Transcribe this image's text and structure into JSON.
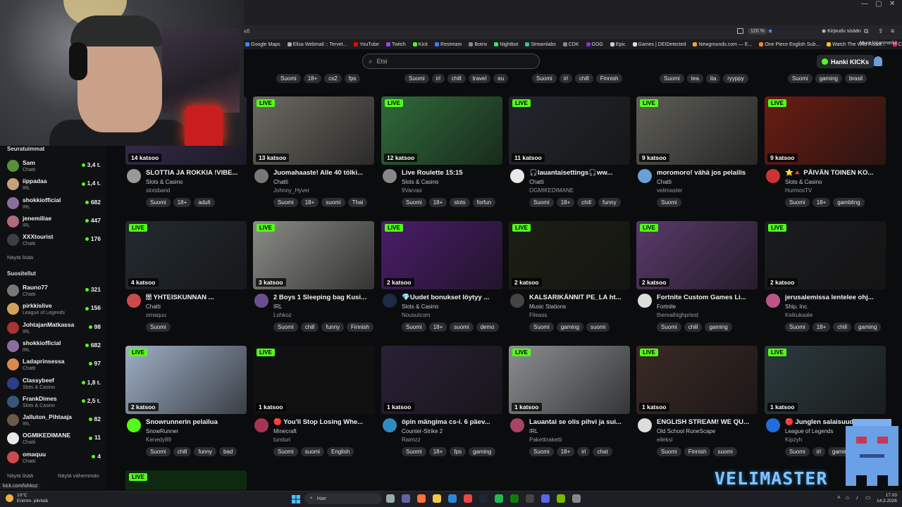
{
  "browser": {
    "url_fragment": "efi",
    "zoom": "120 %",
    "signin": "Kirjaudu sisään",
    "bookmarks": [
      "Google Maps",
      "Elisa Webmail :: Tervet...",
      "YouTube",
      "Twitch",
      "Kick",
      "Restream",
      "Botrix",
      "Nightbot",
      "Streamlabs",
      "CDK",
      "GOG",
      "Epic",
      "Games | DEIDetected",
      "Newgrounds.com — E...",
      "One Piece English Sub...",
      "Watch The Wild Robot...",
      "CineHD - Your Ultimat..."
    ],
    "bookmark_colors": [
      "#4285f4",
      "#aaaaaa",
      "#ff0000",
      "#9146ff",
      "#53fc18",
      "#3b82f6",
      "#888888",
      "#3ae374",
      "#31c3a2",
      "#888888",
      "#8a2be2",
      "#cccccc",
      "#dddddd",
      "#f5a623",
      "#f08a24",
      "#f5c518",
      "#e25",
      "#e25"
    ],
    "other_bookmarks": "Muut kirjanmerkit"
  },
  "header": {
    "search_placeholder": "Etsi",
    "kicks_button": "Hanki KICKs"
  },
  "top_tags": [
    [
      "Suomi",
      "18+",
      "cs2",
      "fps"
    ],
    [
      "Suomi",
      "irl",
      "chill",
      "travel",
      "eu"
    ],
    [
      "Suomi",
      "irl",
      "chill",
      "Finnish"
    ],
    [
      "Suomi",
      "tea",
      "ita",
      "ryyppy"
    ],
    [
      "Suomi",
      "gaming",
      "brasil"
    ]
  ],
  "sidebar": {
    "following_title": "Seuratuimmat",
    "following": [
      {
        "name": "Sam",
        "category": "Chatti",
        "count": "3,4 t.",
        "color": "#5a8f3a"
      },
      {
        "name": "iippadaa",
        "category": "IRL",
        "count": "1,4 t.",
        "color": "#c7a17a"
      },
      {
        "name": "shokkiofficial",
        "category": "IRL",
        "count": "682",
        "color": "#8a6f9e"
      },
      {
        "name": "jenemiliae",
        "category": "IRL",
        "count": "447",
        "color": "#b06a7c"
      },
      {
        "name": "XXXtourist",
        "category": "Chatti",
        "count": "176",
        "color": "#3d3f44"
      }
    ],
    "show_more": "Näytä lisää",
    "recommended_title": "Suositellut",
    "recommended": [
      {
        "name": "Rauno77",
        "category": "Chatti",
        "count": "321",
        "color": "#777"
      },
      {
        "name": "pirkkislive",
        "category": "League of Legends",
        "count": "156",
        "color": "#d1a35a"
      },
      {
        "name": "JohtajanMatkassa",
        "category": "IRL",
        "count": "98",
        "color": "#a33"
      },
      {
        "name": "shokkiofficial",
        "category": "IRL",
        "count": "682",
        "color": "#8a6f9e"
      },
      {
        "name": "Ladaprinsessa",
        "category": "Chatti",
        "count": "97",
        "color": "#d98a4e"
      },
      {
        "name": "Classybeef",
        "category": "Slots & Casino",
        "count": "1,8 t.",
        "color": "#2d3f8a"
      },
      {
        "name": "FrankDimes",
        "category": "Slots & Casino",
        "count": "2,5 t.",
        "color": "#35587a"
      },
      {
        "name": "Jalluton_Pihtaaja",
        "category": "IRL",
        "count": "82",
        "color": "#6b5a48"
      },
      {
        "name": "OGMIKEDIMANE",
        "category": "Chatti",
        "count": "11",
        "color": "#e8e8e8"
      },
      {
        "name": "omaquu",
        "category": "Chatti",
        "count": "4",
        "color": "#c94b4b"
      }
    ],
    "show_more_2": "Näytä lisää",
    "show_less": "Näytä vähemmän"
  },
  "live_label": "LIVE",
  "cards": [
    {
      "viewers": "14 katsoo",
      "title": "SLOTTIA JA ROKKIA !VIBE...",
      "category": "Slots & Casino",
      "user": "slotsband",
      "tags": [
        "Suomi",
        "18+",
        "adult"
      ],
      "thumb": "#3a2f55",
      "avatar": "#999",
      "live": false
    },
    {
      "viewers": "13 katsoo",
      "title": "Juomahaaste! Alle 40 tölki...",
      "category": "Chatti",
      "user": "Johnny_Hyver",
      "tags": [
        "Suomi",
        "18+",
        "suomi",
        "Thai"
      ],
      "thumb": "#6c6a62",
      "avatar": "#777",
      "live": true
    },
    {
      "viewers": "12 katsoo",
      "title": "Live Roulette 15:15",
      "category": "Slots & Casino",
      "user": "9Varvas",
      "tags": [
        "Suomi",
        "18+",
        "slots",
        "forfun"
      ],
      "thumb": "#2f6b3a",
      "avatar": "#888",
      "live": true
    },
    {
      "viewers": "11 katsoo",
      "title": "🎧lauantaisettings🎧ww...",
      "category": "Chatti",
      "user": "OGMIKEDIMANE",
      "tags": [
        "Suomi",
        "18+",
        "chill",
        "funny"
      ],
      "thumb": "#23262d",
      "avatar": "#e8e8e8",
      "live": true
    },
    {
      "viewers": "9 katsoo",
      "title": "moromoro! vähä jos pelailis",
      "category": "Chatti",
      "user": "velimaster",
      "tags": [
        "Suomi"
      ],
      "thumb": "#5f5e58",
      "avatar": "#6aa0d8",
      "live": true
    },
    {
      "viewers": "9 katsoo",
      "title": "⭐🔺 PÄIVÄN TOINEN KO...",
      "category": "Slots & Casino",
      "user": "HurmosTV",
      "tags": [
        "Suomi",
        "18+",
        "gambling"
      ],
      "thumb": "#6a1d12",
      "avatar": "#c33",
      "live": true
    },
    {
      "viewers": "4 katsoo",
      "title": "🕯🕯🕯 YHTEISKUNNAN ...",
      "category": "Chatti",
      "user": "omaquu",
      "tags": [
        "Suomi"
      ],
      "thumb": "#232a30",
      "avatar": "#c94b4b",
      "live": true
    },
    {
      "viewers": "3 katsoo",
      "title": "2 Boys 1 Sleeping bag Kusi...",
      "category": "IRL",
      "user": "Lohkoz",
      "tags": [
        "Suomi",
        "chill",
        "funny",
        "Finnish"
      ],
      "thumb": "#8a8c86",
      "avatar": "#6a4f8e",
      "live": true
    },
    {
      "viewers": "2 katsoo",
      "title": "💎Uudet bonukset löytyy ...",
      "category": "Slots & Casino",
      "user": "Nousutcom",
      "tags": [
        "Suomi",
        "18+",
        "suomi",
        "demo"
      ],
      "thumb": "#4a1d6a",
      "avatar": "#1f2a44",
      "live": true
    },
    {
      "viewers": "2 katsoo",
      "title": "KALSARIKÄNNIT PE_LA ht...",
      "category": "Music Stations",
      "user": "Fileass",
      "tags": [
        "Suomi",
        "gaming",
        "suomi"
      ],
      "thumb": "#1c1f14",
      "avatar": "#444",
      "live": true
    },
    {
      "viewers": "2 katsoo",
      "title": "Fortnite Custom Games Li...",
      "category": "Fortnite",
      "user": "therealhighpriest",
      "tags": [
        "Suomi",
        "chill",
        "gaming"
      ],
      "thumb": "#5a3a6a",
      "avatar": "#ddd",
      "live": true
    },
    {
      "viewers": "2 katsoo",
      "title": "jerusalemissa lentelee ohj...",
      "category": "Ship, Inc.",
      "user": "Keikukaale",
      "tags": [
        "Suomi",
        "18+",
        "chill",
        "gaming"
      ],
      "thumb": "#1a1b1d",
      "avatar": "#b58",
      "live": true
    },
    {
      "viewers": "2 katsoo",
      "title": "Snowrunnerin pelailua",
      "category": "SnowRunner",
      "user": "Kenedy89",
      "tags": [
        "Suomi",
        "chill",
        "funny",
        "bad"
      ],
      "thumb": "#9fb0c6",
      "avatar": "#53fc18",
      "live": true
    },
    {
      "viewers": "1 katsoo",
      "title": "🔴 You'll Stop Losing Whe...",
      "category": "Minecraft",
      "user": "tursturi",
      "tags": [
        "Suomi",
        "suomi",
        "English"
      ],
      "thumb": "#111113",
      "avatar": "#aa3355",
      "live": true
    },
    {
      "viewers": "1 katsoo",
      "title": "öpin mängima cs-i. 6 päev...",
      "category": "Counter-Strike 2",
      "user": "Raimzz",
      "tags": [
        "Suomi",
        "18+",
        "fps",
        "gaming"
      ],
      "thumb": "#2a2035",
      "avatar": "#2e8bc0",
      "live": false
    },
    {
      "viewers": "1 katsoo",
      "title": "Lauantai se olis pihvi ja sui...",
      "category": "IRL",
      "user": "Pakettiraketti",
      "tags": [
        "Suomi",
        "18+",
        "irl",
        "chat"
      ],
      "thumb": "#8c8f92",
      "avatar": "#a46",
      "live": true
    },
    {
      "viewers": "1 katsoo",
      "title": "ENGLISH STREAM! WE QU...",
      "category": "Old School RuneScape",
      "user": "eileksi",
      "tags": [
        "Suomi",
        "Finnish",
        "suomi"
      ],
      "thumb": "#3a2a25",
      "avatar": "#ddd",
      "live": true
    },
    {
      "viewers": "1 katsoo",
      "title": "🔴 Junglen salaisuud...",
      "category": "League of Legends",
      "user": "Kipzyh",
      "tags": [
        "Suomi",
        "irl",
        "gaming"
      ],
      "thumb": "#2c3a3e",
      "avatar": "#1e6fd9",
      "live": true
    }
  ],
  "overlay": {
    "brand": "VELIMASTER"
  },
  "statusbar": "kick.com/lohkoz",
  "taskbar": {
    "weather_temp": "10°C",
    "weather_desc": "Enimm. pilvistä",
    "search": "Hae",
    "time": "17.03",
    "date": "14.3.2026"
  }
}
